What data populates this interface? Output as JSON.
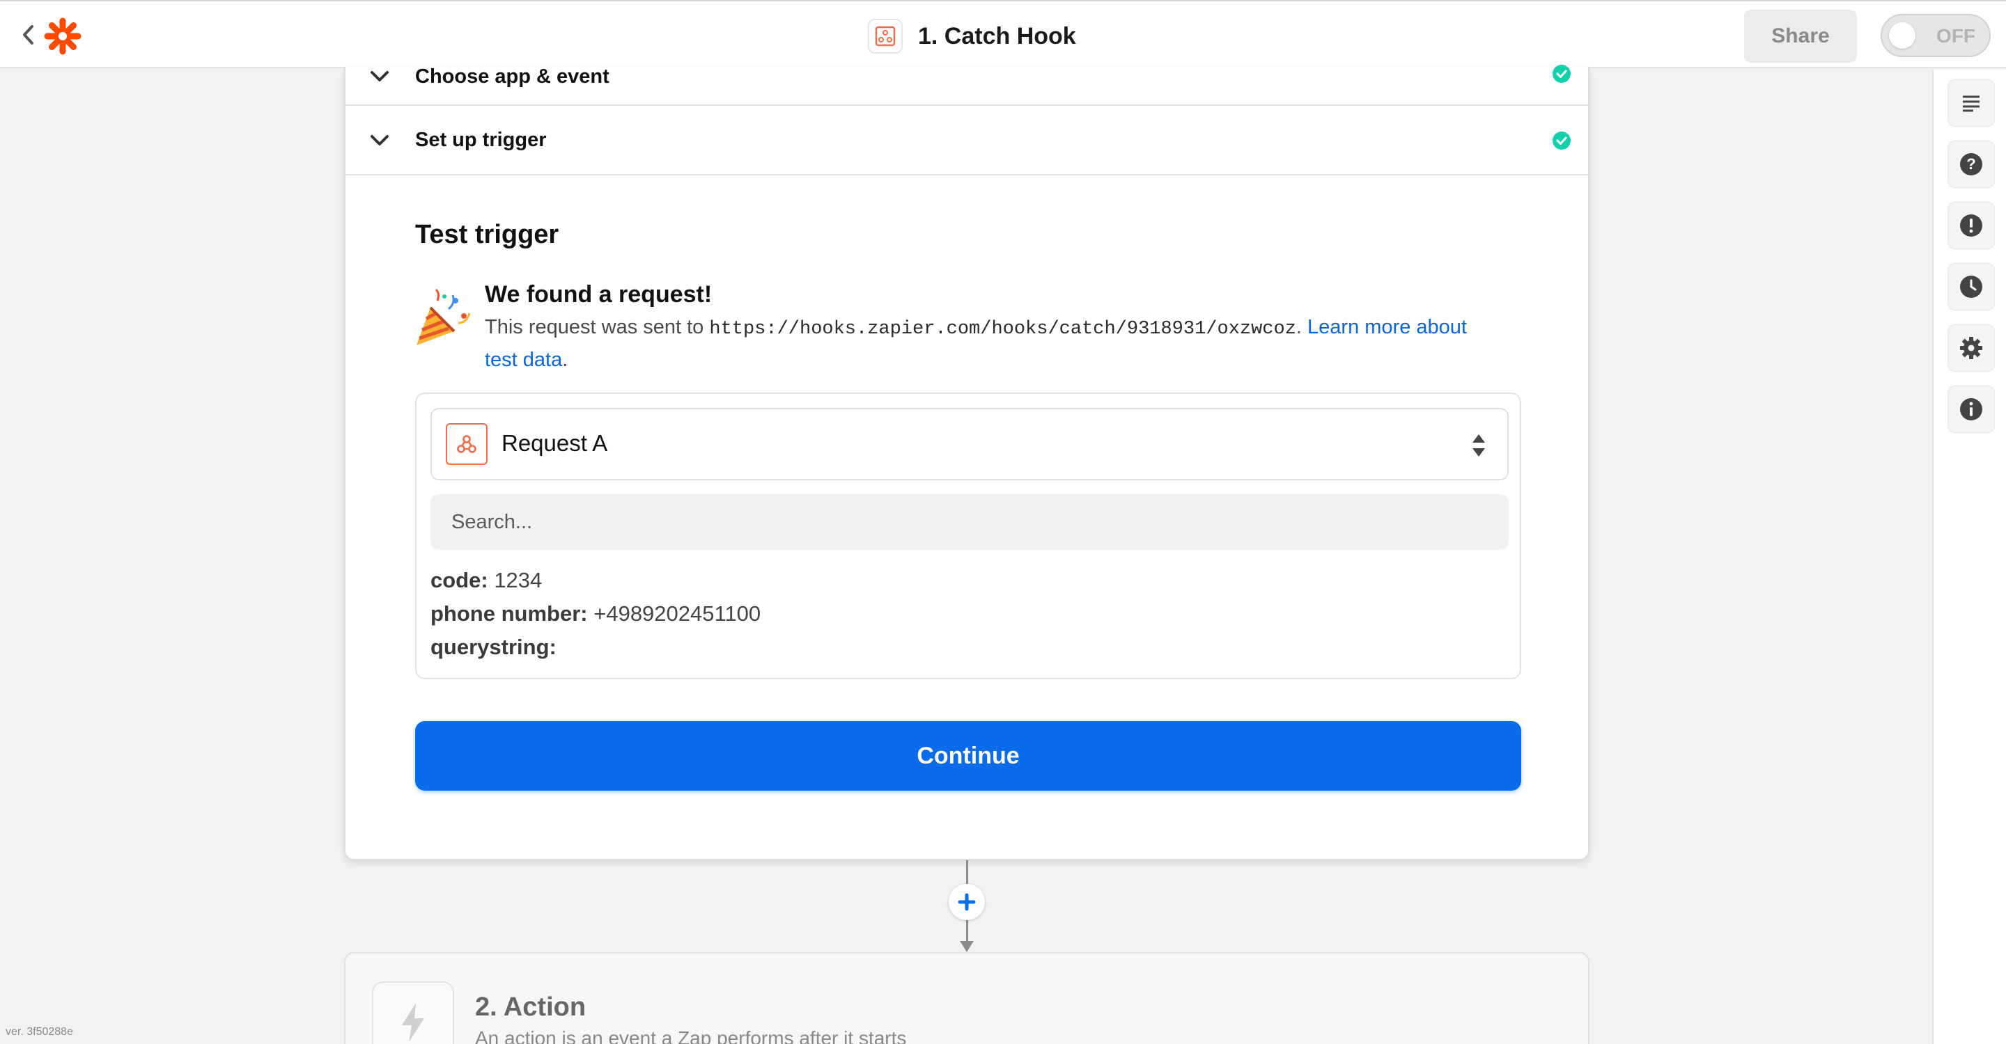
{
  "header": {
    "zap_title": "1. Catch Hook",
    "share_label": "Share",
    "toggle_label": "OFF"
  },
  "steps": {
    "choose_app": "Choose app & event",
    "setup_trigger": "Set up trigger"
  },
  "test": {
    "section_title": "Test trigger",
    "found_title": "We found a request!",
    "desc_prefix": "This request was sent to ",
    "hook_url": "https://hooks.zapier.com/hooks/catch/9318931/oxzwcoz",
    "desc_dot": ".",
    "learn_more": "Learn more about test data",
    "desc_end": "."
  },
  "request": {
    "selected": "Request A",
    "search_placeholder": "Search...",
    "fields": [
      {
        "key": "code:",
        "value": "1234"
      },
      {
        "key": "phone number:",
        "value": "+4989202451100"
      },
      {
        "key": "querystring:",
        "value": ""
      }
    ]
  },
  "continue_label": "Continue",
  "action": {
    "title": "2. Action",
    "desc": "An action is an event a Zap performs after it starts"
  },
  "version": "ver. 3f50288e",
  "colors": {
    "brand_orange": "#ff4a00",
    "primary_blue": "#0a6ceb",
    "success_green": "#13d0ab"
  },
  "icons": [
    "back-chevron-icon",
    "zapier-logo-icon",
    "webhook-icon",
    "list-icon",
    "help-icon",
    "alert-icon",
    "history-icon",
    "settings-icon",
    "info-icon",
    "check-circle-icon",
    "party-popper-icon",
    "plus-icon",
    "lightning-icon"
  ]
}
